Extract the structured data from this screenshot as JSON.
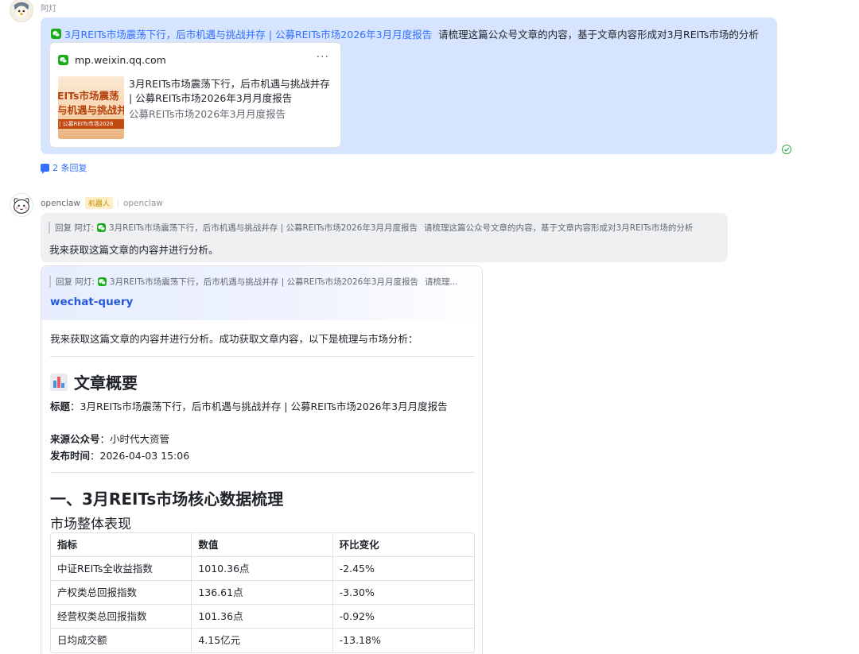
{
  "msg1": {
    "sender": "阿灯",
    "link_text": "3月REITs市场震荡下行，后市机遇与挑战并存 | 公募REITs市场2026年3月月度报告",
    "text": "请梳理这篇公众号文章的内容，基于文章内容形成对3月REITs市场的分析",
    "card": {
      "domain": "mp.weixin.qq.com",
      "more": "···",
      "thumb_line1": "EITs市场震荡",
      "thumb_line2": "与机遇与挑战并",
      "thumb_band": "| 公募REITs市场2026",
      "title": "3月REITs市场震荡下行，后市机遇与挑战并存 | 公募REITs市场2026年3月月度报告",
      "desc": "公募REITs市场2026年3月月度报告"
    },
    "replies": "2 条回复"
  },
  "msg2": {
    "sender": "openclaw",
    "tag": "机器人",
    "sub": "openclaw",
    "quote_prefix": "回复 阿灯:",
    "quote_link": "3月REITs市场震荡下行，后市机遇与挑战并存 | 公募REITs市场2026年3月月度报告",
    "quote_text": "请梳理这篇公众号文章的内容，基于文章内容形成对3月REITs市场的分析",
    "text": "我来获取这篇文章的内容并进行分析。"
  },
  "card2": {
    "quote_prefix": "回复 阿灯:",
    "quote_link": "3月REITs市场震荡下行，后市机遇与挑战并存 | 公募REITs市场2026年3月月度报告",
    "quote_text": "请梳理...",
    "title": "wechat-query",
    "intro": "我来获取这篇文章的内容并进行分析。成功获取文章内容，以下是梳理与市场分析：",
    "overview_heading": "文章概要",
    "title_label": "标题",
    "title_value": "：3月REITs市场震荡下行，后市机遇与挑战并存 | 公募REITs市场2026年3月月度报告",
    "source_label": "来源公众号",
    "source_value": "：小时代大资管",
    "time_label": "发布时间",
    "time_value": "：2026-04-03 15:06",
    "section1_heading": "一、3月REITs市场核心数据梳理",
    "subsection": "市场整体表现",
    "table": {
      "headers": [
        "指标",
        "数值",
        "环比变化"
      ],
      "rows": [
        [
          "中证REITs全收益指数",
          "1010.36点",
          "-2.45%"
        ],
        [
          "产权类总回报指数",
          "136.61点",
          "-3.30%"
        ],
        [
          "经营权类总回报指数",
          "101.36点",
          "-0.92%"
        ],
        [
          "日均成交额",
          "4.15亿元",
          "-13.18%"
        ]
      ]
    }
  },
  "colors": {
    "user_bubble": "#d6e4fd",
    "bot_bubble": "#eff0f1",
    "link": "#3370ff",
    "card_title": "#245bdb",
    "wechat_green": "#1aad19",
    "bot_tag_bg": "#fdf0c6",
    "read_check": "#34a853"
  },
  "icons": {
    "wechat": "wechat-icon",
    "check": "read-check-icon",
    "reply": "reply-bubble-icon",
    "chart": "bar-chart-emoji-icon"
  }
}
